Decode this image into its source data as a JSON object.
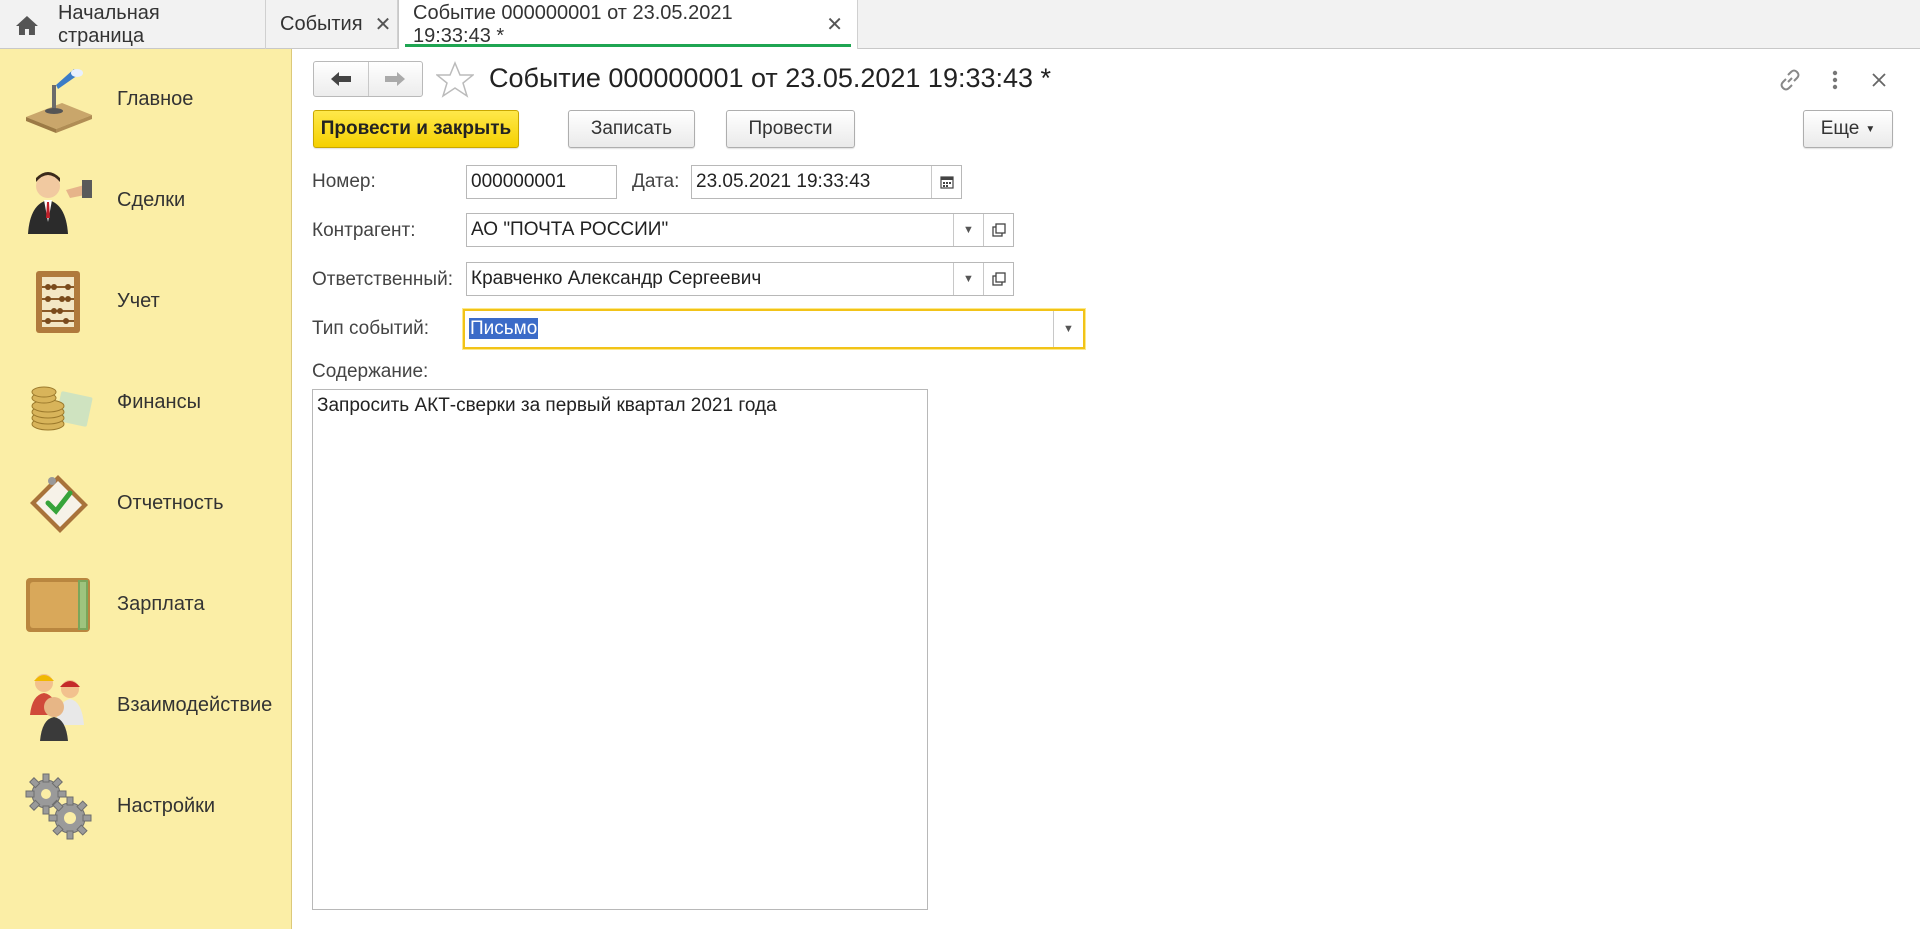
{
  "tabs": {
    "home": "Начальная страница",
    "events": "События",
    "document": "Событие 000000001 от 23.05.2021 19:33:43 *"
  },
  "sidebar": {
    "items": [
      {
        "label": "Главное",
        "icon": "desk-lamp-icon"
      },
      {
        "label": "Сделки",
        "icon": "handshake-icon"
      },
      {
        "label": "Учет",
        "icon": "abacus-icon"
      },
      {
        "label": "Финансы",
        "icon": "coins-icon"
      },
      {
        "label": "Отчетность",
        "icon": "clipboard-check-icon"
      },
      {
        "label": "Зарплата",
        "icon": "wallet-icon"
      },
      {
        "label": "Взаимодействие",
        "icon": "people-icon"
      },
      {
        "label": "Настройки",
        "icon": "gears-icon"
      }
    ]
  },
  "header": {
    "title": "Событие 000000001 от 23.05.2021 19:33:43 *"
  },
  "toolbar": {
    "post_close": "Провести и закрыть",
    "save": "Записать",
    "post": "Провести",
    "more": "Еще"
  },
  "form": {
    "number_label": "Номер:",
    "number_value": "000000001",
    "date_label": "Дата:",
    "date_value": "23.05.2021 19:33:43",
    "counterparty_label": "Контрагент:",
    "counterparty_value": "АО \"ПОЧТА РОССИИ\"",
    "responsible_label": "Ответственный:",
    "responsible_value": "Кравченко Александр Сергеевич",
    "event_type_label": "Тип событий:",
    "event_type_value": "Письмо",
    "content_label": "Содержание:",
    "content_value": "Запросить АКТ-сверки за первый квартал 2021 года"
  },
  "colors": {
    "sidebar_bg": "#fbeea6",
    "primary_button": "#f5d000",
    "active_tab_underline": "#1fa552",
    "focus_border": "#f2c318",
    "selection": "#3b6bc8"
  }
}
